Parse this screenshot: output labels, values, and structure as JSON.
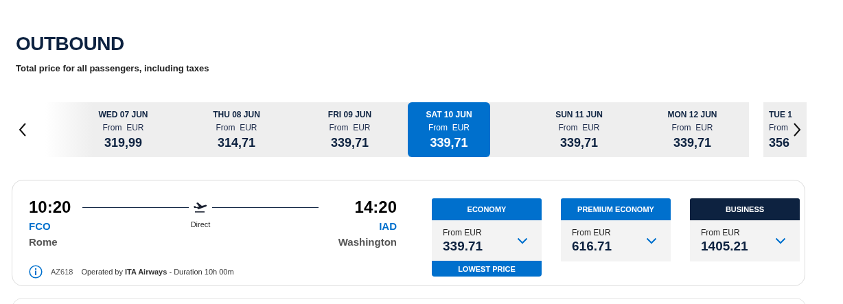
{
  "title": "OUTBOUND",
  "subtitle": "Total price for all passengers, including taxes",
  "date_strip": {
    "days": [
      {
        "date": "WED 07 JUN",
        "from": "From  EUR",
        "price": "319,99",
        "selected": false
      },
      {
        "date": "THU 08 JUN",
        "from": "From  EUR",
        "price": "314,71",
        "selected": false
      },
      {
        "date": "FRI 09 JUN",
        "from": "From  EUR",
        "price": "339,71",
        "selected": false
      },
      {
        "date": "SAT 10 JUN",
        "from": "From  EUR",
        "price": "339,71",
        "selected": true
      },
      {
        "date": "SUN 11 JUN",
        "from": "From  EUR",
        "price": "339,71",
        "selected": false
      },
      {
        "date": "MON 12 JUN",
        "from": "From  EUR",
        "price": "339,71",
        "selected": false
      },
      {
        "date": "TUE 1",
        "from": "From",
        "price": "356",
        "selected": false
      }
    ]
  },
  "flight": {
    "departure_time": "10:20",
    "departure_code": "FCO",
    "departure_city": "Rome",
    "stops": "Direct",
    "arrival_time": "14:20",
    "arrival_code": "IAD",
    "arrival_city": "Washington",
    "flight_number": "AZ618",
    "details": "Operated by **ITA Airways** - Duration 10h 00m"
  },
  "fares": [
    {
      "cabin": "ECONOMY",
      "color": "#0070cd",
      "from": "From EUR",
      "price": "339.71",
      "badge": "LOWEST PRICE"
    },
    {
      "cabin": "PREMIUM ECONOMY",
      "color": "#0070cd",
      "from": "From EUR",
      "price": "616.71"
    },
    {
      "cabin": "BUSINESS",
      "color": "#0d2240",
      "from": "From EUR",
      "price": "1405.21"
    }
  ]
}
